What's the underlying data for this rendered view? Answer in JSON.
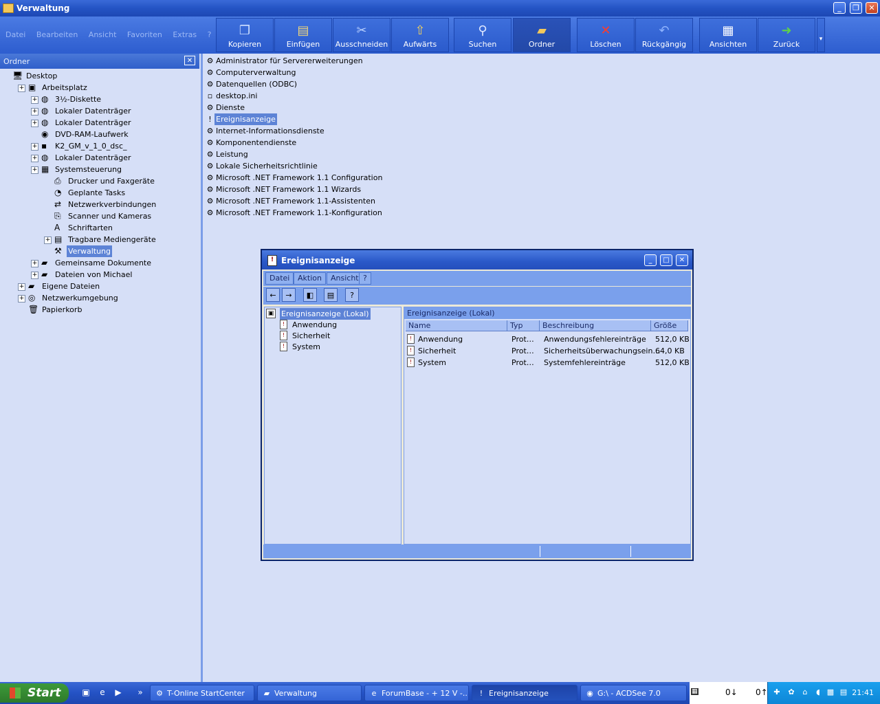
{
  "window": {
    "title": "Verwaltung"
  },
  "menubar": [
    "Datei",
    "Bearbeiten",
    "Ansicht",
    "Favoriten",
    "Extras",
    "?"
  ],
  "toolbar": [
    {
      "label": "Kopieren",
      "icon": "copy-icon"
    },
    {
      "label": "Einfügen",
      "icon": "paste-icon"
    },
    {
      "label": "Ausschneiden",
      "icon": "cut-icon"
    },
    {
      "label": "Aufwärts",
      "icon": "up-folder-icon"
    },
    {
      "label": "Suchen",
      "icon": "search-icon"
    },
    {
      "label": "Ordner",
      "icon": "folders-icon"
    },
    {
      "label": "Löschen",
      "icon": "delete-icon"
    },
    {
      "label": "Rückgängig",
      "icon": "undo-icon"
    },
    {
      "label": "Ansichten",
      "icon": "views-icon"
    },
    {
      "label": "Zurück",
      "icon": "back-icon"
    }
  ],
  "folderpane": {
    "title": "Ordner",
    "tree": [
      {
        "label": "Desktop"
      },
      {
        "label": "Arbeitsplatz"
      },
      {
        "label": "3½-Diskette"
      },
      {
        "label": "Lokaler Datenträger"
      },
      {
        "label": "Lokaler Datenträger"
      },
      {
        "label": "DVD-RAM-Laufwerk"
      },
      {
        "label": "K2_GM_v_1_0_dsc_"
      },
      {
        "label": "Lokaler Datenträger"
      },
      {
        "label": "Systemsteuerung"
      },
      {
        "label": "Drucker und Faxgeräte"
      },
      {
        "label": "Geplante Tasks"
      },
      {
        "label": "Netzwerkverbindungen"
      },
      {
        "label": "Scanner und Kameras"
      },
      {
        "label": "Schriftarten"
      },
      {
        "label": "Tragbare Mediengeräte"
      },
      {
        "label": "Verwaltung"
      },
      {
        "label": "Gemeinsame Dokumente"
      },
      {
        "label": "Dateien von Michael"
      },
      {
        "label": "Eigene Dateien"
      },
      {
        "label": "Netzwerkumgebung"
      },
      {
        "label": "Papierkorb"
      }
    ]
  },
  "files": [
    "Administrator für Servererweiterungen",
    "Computerverwaltung",
    "Datenquellen (ODBC)",
    "desktop.ini",
    "Dienste",
    "Ereignisanzeige",
    "Internet-Informationsdienste",
    "Komponentendienste",
    "Leistung",
    "Lokale Sicherheitsrichtlinie",
    "Microsoft .NET Framework 1.1 Configuration",
    "Microsoft .NET Framework 1.1 Wizards",
    "Microsoft .NET Framework 1.1-Assistenten",
    "Microsoft .NET Framework 1.1-Konfiguration"
  ],
  "eventviewer": {
    "title": "Ereignisanzeige",
    "menu": [
      "Datei",
      "Aktion",
      "Ansicht",
      "?"
    ],
    "tree_root": "Ereignisanzeige (Lokal)",
    "tree_children": [
      "Anwendung",
      "Sicherheit",
      "System"
    ],
    "right_header": "Ereignisanzeige (Lokal)",
    "columns": [
      "Name",
      "Typ",
      "Beschreibung",
      "Größe"
    ],
    "rows": [
      {
        "name": "Anwendung",
        "typ": "Prot…",
        "beschreibung": "Anwendungsfehlereinträge",
        "groesse": "512,0 KB"
      },
      {
        "name": "Sicherheit",
        "typ": "Prot…",
        "beschreibung": "Sicherheitsüberwachungsein…",
        "groesse": "64,0 KB"
      },
      {
        "name": "System",
        "typ": "Prot…",
        "beschreibung": "Systemfehlereinträge",
        "groesse": "512,0 KB"
      }
    ]
  },
  "taskbar": {
    "start": "Start",
    "tasks": [
      "T-Online StartCenter",
      "Verwaltung",
      "ForumBase - + 12 V -...",
      "Ereignisanzeige",
      "G:\\ - ACDSee 7.0"
    ],
    "net_down": "0↓",
    "net_up": "0↑",
    "clock": "21:41"
  }
}
